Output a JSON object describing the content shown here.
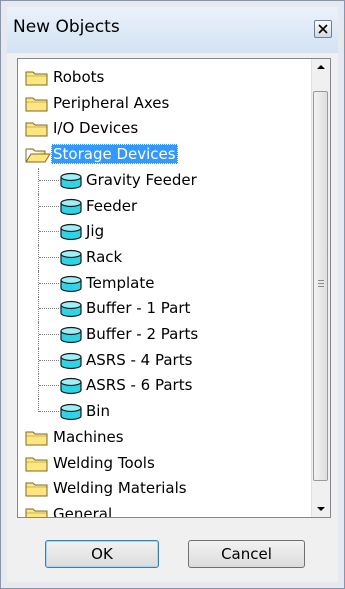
{
  "window": {
    "title": "New Objects"
  },
  "tree": {
    "items": [
      {
        "label": "Robots",
        "icon": "folder-closed-icon",
        "level": 0
      },
      {
        "label": "Peripheral Axes",
        "icon": "folder-closed-icon",
        "level": 0
      },
      {
        "label": "I/O Devices",
        "icon": "folder-closed-icon",
        "level": 0
      },
      {
        "label": "Storage Devices",
        "icon": "folder-open-icon",
        "level": 0,
        "selected": true,
        "expanded": true
      },
      {
        "label": "Gravity Feeder",
        "icon": "cylinder-icon",
        "level": 1
      },
      {
        "label": "Feeder",
        "icon": "cylinder-icon",
        "level": 1
      },
      {
        "label": "Jig",
        "icon": "cylinder-icon",
        "level": 1
      },
      {
        "label": "Rack",
        "icon": "cylinder-icon",
        "level": 1
      },
      {
        "label": "Template",
        "icon": "cylinder-icon",
        "level": 1
      },
      {
        "label": "Buffer - 1 Part",
        "icon": "cylinder-icon",
        "level": 1
      },
      {
        "label": "Buffer - 2 Parts",
        "icon": "cylinder-icon",
        "level": 1
      },
      {
        "label": "ASRS - 4 Parts",
        "icon": "cylinder-icon",
        "level": 1
      },
      {
        "label": "ASRS - 6 Parts",
        "icon": "cylinder-icon",
        "level": 1
      },
      {
        "label": "Bin",
        "icon": "cylinder-icon",
        "level": 1
      },
      {
        "label": "Machines",
        "icon": "folder-closed-icon",
        "level": 0
      },
      {
        "label": "Welding Tools",
        "icon": "folder-closed-icon",
        "level": 0
      },
      {
        "label": "Welding Materials",
        "icon": "folder-closed-icon",
        "level": 0
      },
      {
        "label": "General",
        "icon": "folder-closed-icon",
        "level": 0
      }
    ]
  },
  "buttons": {
    "ok_label": "OK",
    "cancel_label": "Cancel"
  },
  "colors": {
    "selection": "#3399ff",
    "folder": "#ffe680",
    "cylinder": "#2fd3e6"
  }
}
